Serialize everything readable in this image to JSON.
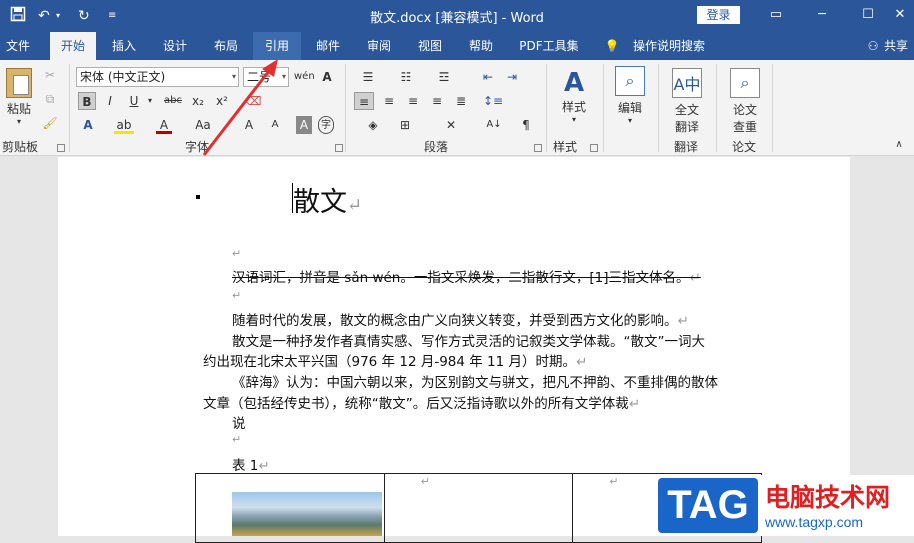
{
  "titlebar": {
    "title": "散文.docx [兼容模式] - Word",
    "login": "登录"
  },
  "tabs": [
    {
      "label": "文件"
    },
    {
      "label": "开始"
    },
    {
      "label": "插入"
    },
    {
      "label": "设计"
    },
    {
      "label": "布局"
    },
    {
      "label": "引用"
    },
    {
      "label": "邮件"
    },
    {
      "label": "审阅"
    },
    {
      "label": "视图"
    },
    {
      "label": "帮助"
    },
    {
      "label": "PDF工具集"
    },
    {
      "label": "操作说明搜索"
    }
  ],
  "share": "共享",
  "ribbon": {
    "paste": "粘贴",
    "clipboard": "剪贴板",
    "font_name": "宋体 (中文正文)",
    "font_size": "二号",
    "font_group": "字体",
    "paragraph_group": "段落",
    "styles": "样式",
    "styles_group": "样式",
    "edit": "编辑",
    "translate_btn_1": "全文",
    "translate_btn_2": "翻译",
    "translate_group": "翻译",
    "paper_btn_1": "论文",
    "paper_btn_2": "查重",
    "paper_group": "论文"
  },
  "document": {
    "title": "散文",
    "line1": "汉语词汇，拼音是 sǎn wén。一指文采焕发，二指散行文，[1]三指文体名。",
    "line2": "随着时代的发展，散文的概念由广义向狭义转变，并受到西方文化的影响。",
    "line3a": "散文是一种抒发作者真情实感、写作方式灵活的记叙类文学体裁。“散文”一词大",
    "line3b": "约出现在北宋太平兴国（976 年 12 月-984 年 11 月）时期。",
    "line4a": "《辞海》认为：中国六朝以来，为区别韵文与骈文，把凡不押韵、不重排偶的散体",
    "line4b": "文章（包括经传史书），统称“散文”。后又泛指诗歌以外的所有文学体裁",
    "line4c": "说",
    "table_caption": "表  1"
  },
  "watermark": {
    "tag": "TAG",
    "site_name": "电脑技术网",
    "url": "www.tagxp.com"
  }
}
